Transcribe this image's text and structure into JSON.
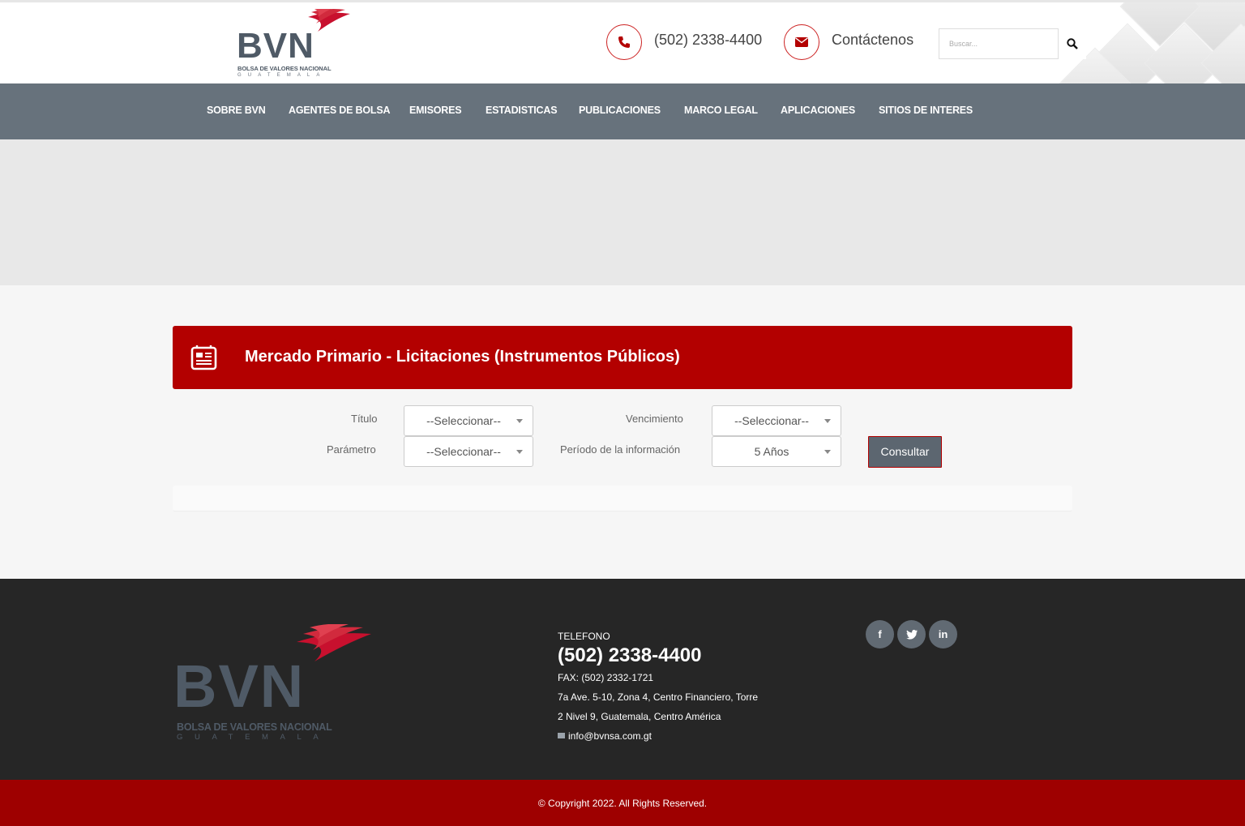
{
  "brand": {
    "logo_text": "BVN",
    "logo_subtitle": "BOLSA DE VALORES NACIONAL",
    "logo_country": "GUATEMALA",
    "colors": {
      "primary_red": "#b30000",
      "nav_gray": "#67727c",
      "footer_dark": "#262626",
      "copy_red": "#9e0000"
    }
  },
  "header": {
    "phone": "(502) 2338-4400",
    "contact_label": "Contáctenos",
    "search_placeholder": "Buscar...",
    "icons": {
      "phone": "phone-icon",
      "mail": "envelope-icon",
      "search": "search-icon"
    }
  },
  "nav": {
    "items": [
      {
        "label": "SOBRE BVN"
      },
      {
        "label": "AGENTES DE BOLSA"
      },
      {
        "label": "EMISORES"
      },
      {
        "label": "ESTADISTICAS"
      },
      {
        "label": "PUBLICACIONES"
      },
      {
        "label": "MARCO LEGAL"
      },
      {
        "label": "APLICACIONES"
      },
      {
        "label": "SITIOS DE INTERES"
      }
    ]
  },
  "main": {
    "title": "Mercado Primario - Licitaciones (Instrumentos Públicos)",
    "filters": {
      "titulo_label": "Título",
      "titulo_value": "--Seleccionar--",
      "vencimiento_label": "Vencimiento",
      "vencimiento_value": "--Seleccionar--",
      "parametro_label": "Parámetro",
      "parametro_value": "--Seleccionar--",
      "periodo_label": "Período de la información",
      "periodo_value": "5 Años"
    },
    "submit_label": "Consultar"
  },
  "footer": {
    "tel_label": "TELEFONO",
    "tel": "(502) 2338-4400",
    "fax": "FAX: (502) 2332-1721",
    "address_1": "7a Ave. 5-10, Zona 4, Centro Financiero, Torre",
    "address_2": "2 Nivel 9, Guatemala, Centro América",
    "email": "info@bvnsa.com.gt",
    "social": [
      "f",
      "t",
      "in"
    ],
    "copyright": "© Copyright 2022. All Rights Reserved."
  }
}
